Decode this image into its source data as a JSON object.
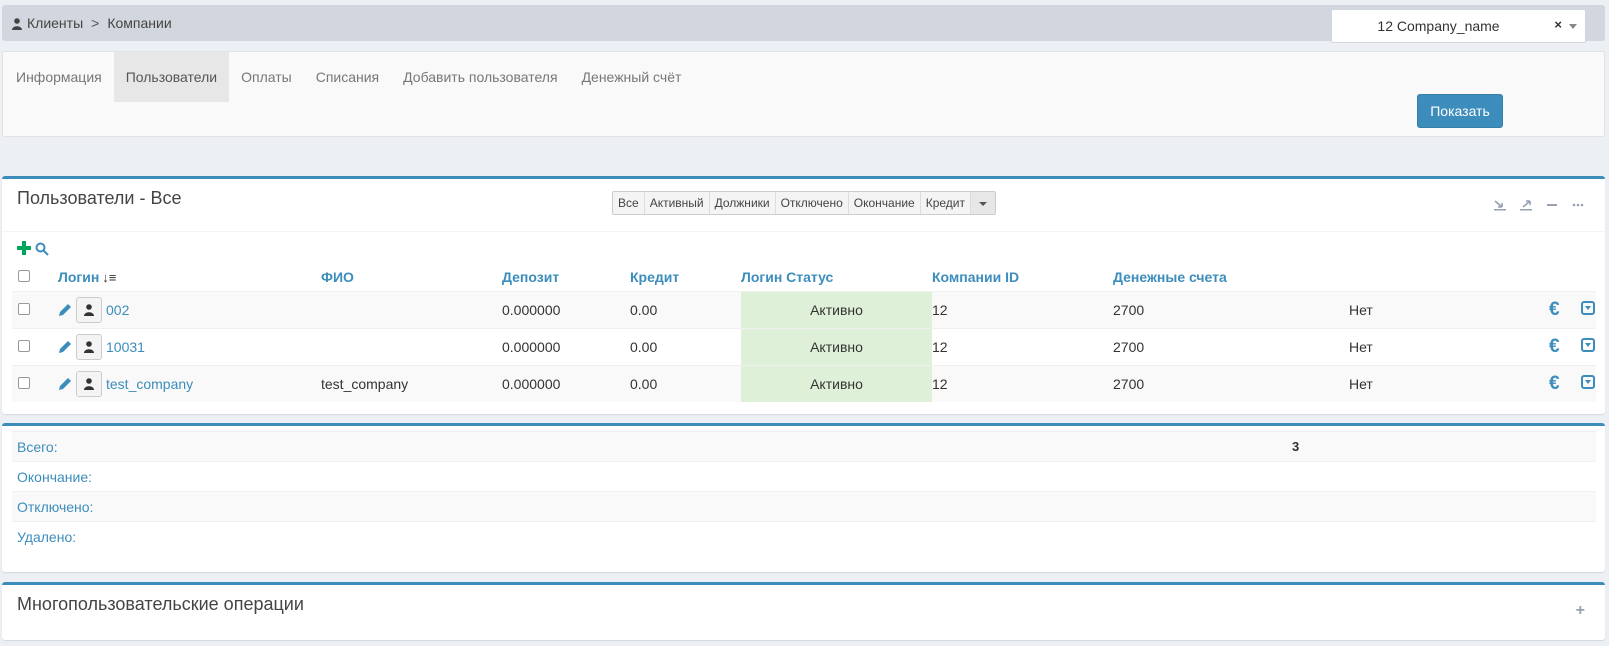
{
  "breadcrumb": {
    "root": "Клиенты",
    "separator": ">",
    "current": "Компании"
  },
  "tabs": [
    {
      "label": "Информация",
      "active": false
    },
    {
      "label": "Пользователи",
      "active": true
    },
    {
      "label": "Оплаты",
      "active": false
    },
    {
      "label": "Списания",
      "active": false
    },
    {
      "label": "Добавить пользователя",
      "active": false
    },
    {
      "label": "Денежный счёт",
      "active": false
    }
  ],
  "company_select": {
    "value": "12 Company_name",
    "clear": "×"
  },
  "show_button": "Показать",
  "users_box": {
    "title": "Пользователи - Все",
    "filters": [
      "Все",
      "Активный",
      "Должники",
      "Отключено",
      "Окончание",
      "Кредит"
    ],
    "columns": [
      "Логин",
      "ФИО",
      "Депозит",
      "Кредит",
      "Логин Статус",
      "Компании ID",
      "Денежные счета"
    ],
    "rows": [
      {
        "login": "002",
        "fio": "",
        "deposit": "0.000000",
        "credit": "0.00",
        "status": "Активно",
        "company_id": "12",
        "accounts": "2700",
        "extra": "Нет"
      },
      {
        "login": "10031",
        "fio": "",
        "deposit": "0.000000",
        "credit": "0.00",
        "status": "Активно",
        "company_id": "12",
        "accounts": "2700",
        "extra": "Нет"
      },
      {
        "login": "test_company",
        "fio": "test_company",
        "deposit": "0.000000",
        "credit": "0.00",
        "status": "Активно",
        "company_id": "12",
        "accounts": "2700",
        "extra": "Нет"
      }
    ]
  },
  "summary": {
    "rows": [
      {
        "label": "Всего:",
        "value": "3"
      },
      {
        "label": "Окончание:",
        "value": ""
      },
      {
        "label": "Отключено:",
        "value": ""
      },
      {
        "label": "Удалено:",
        "value": ""
      }
    ]
  },
  "multi_box": {
    "title": "Многопользовательские операции"
  },
  "colors": {
    "accent": "#3c8dbc",
    "success": "#00a65a",
    "status_bg": "#dff0d8"
  }
}
